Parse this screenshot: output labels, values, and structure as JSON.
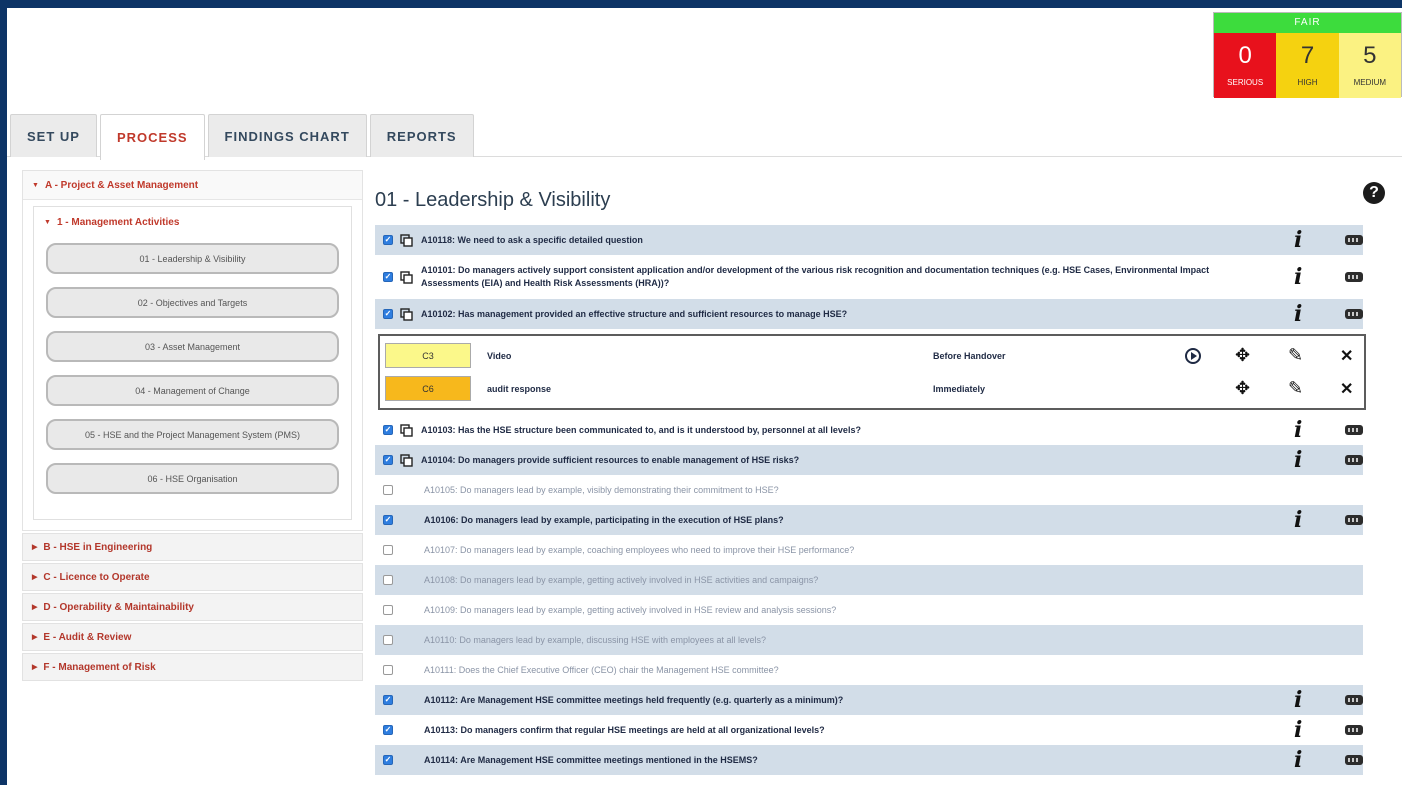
{
  "score": {
    "status": "FAIR",
    "serious": {
      "value": "0",
      "label": "SERIOUS",
      "color": "#e8111c"
    },
    "high": {
      "value": "7",
      "label": "HIGH",
      "color": "#f5d210"
    },
    "medium": {
      "value": "5",
      "label": "MEDIUM",
      "color": "#fbf282"
    }
  },
  "tabs": [
    "SET UP",
    "PROCESS",
    "FINDINGS CHART",
    "REPORTS"
  ],
  "active_tab": "PROCESS",
  "sidebar": {
    "section": "A - Project & Asset Management",
    "subsection": "1 - Management Activities",
    "items": [
      "01 - Leadership & Visibility",
      "02 - Objectives and Targets",
      "03 - Asset Management",
      "04 - Management of Change",
      "05 - HSE and the Project Management System (PMS)",
      "06 - HSE Organisation"
    ],
    "other_sections": [
      "B - HSE in Engineering",
      "C - Licence to Operate",
      "D - Operability & Maintainability",
      "E - Audit & Review",
      "F - Management of Risk"
    ]
  },
  "main": {
    "title": "01 - Leadership & Visibility",
    "questions": [
      {
        "text": "A10118: We need to ask a specific detailed question",
        "checked": true
      },
      {
        "text": "A10101: Do managers actively support consistent application and/or development of the various risk recognition and documentation techniques (e.g. HSE Cases, Environmental Impact Assessments (EIA) and Health Risk Assessments (HRA))?",
        "checked": true
      },
      {
        "text": "A10102: Has management provided an effective structure and sufficient resources to manage HSE?",
        "checked": true
      },
      {
        "text": "A10103: Has the HSE structure been communicated to, and is it understood by, personnel at all levels?",
        "checked": true
      },
      {
        "text": "A10104: Do managers provide sufficient resources to enable management of HSE risks?",
        "checked": true
      },
      {
        "text": "A10105: Do managers lead by example, visibly demonstrating their commitment to HSE?",
        "checked": false
      },
      {
        "text": "A10106: Do managers lead by example, participating in the execution of HSE plans?",
        "checked": true
      },
      {
        "text": "A10107: Do managers lead by example, coaching employees who need to improve their HSE performance?",
        "checked": false
      },
      {
        "text": "A10108: Do managers lead by example, getting actively involved in HSE activities and campaigns?",
        "checked": false
      },
      {
        "text": "A10109: Do managers lead by example, getting actively involved in HSE review and analysis sessions?",
        "checked": false
      },
      {
        "text": "A10110: Do managers lead by example, discussing HSE with employees at all levels?",
        "checked": false
      },
      {
        "text": "A10111: Does the Chief Executive Officer (CEO) chair the Management HSE committee?",
        "checked": false
      },
      {
        "text": "A10112: Are Management HSE committee meetings held frequently (e.g. quarterly as a minimum)?",
        "checked": true
      },
      {
        "text": "A10113: Do managers confirm that regular HSE meetings are held at all organizational levels?",
        "checked": true
      },
      {
        "text": "A10114: Are Management HSE committee meetings mentioned in the HSEMS?",
        "checked": true
      }
    ],
    "actions": [
      {
        "code": "C3",
        "color": "#fbf88a",
        "title": "Video",
        "when": "Before Handover"
      },
      {
        "code": "C6",
        "color": "#f7b81c",
        "title": "audit response",
        "when": "Immediately"
      }
    ]
  }
}
